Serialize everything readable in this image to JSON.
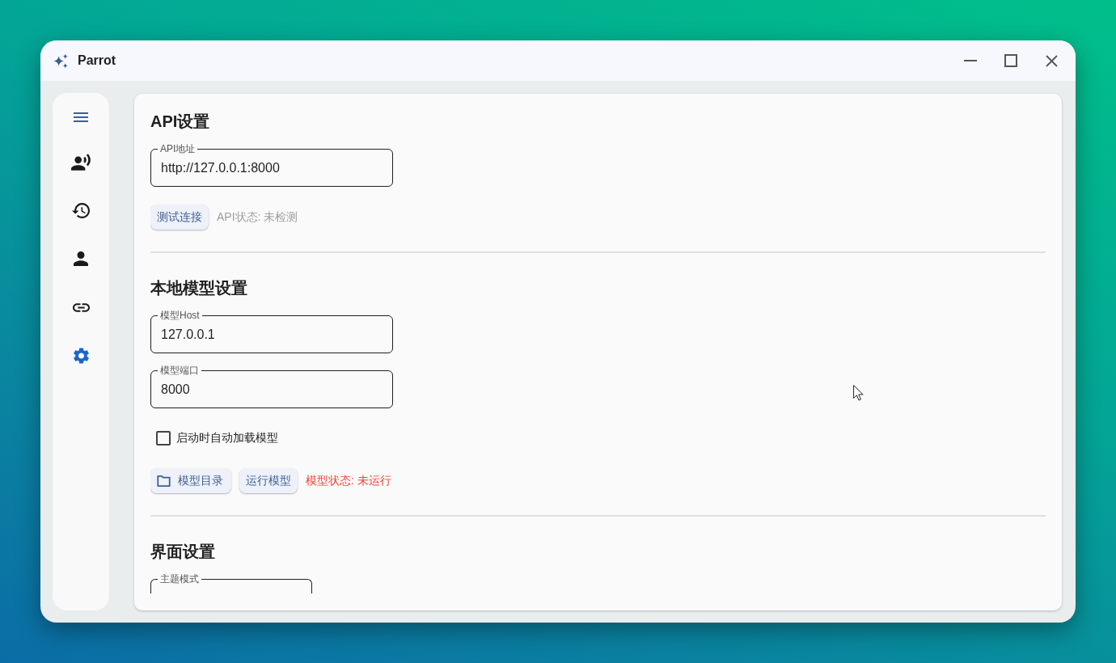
{
  "window": {
    "title": "Parrot"
  },
  "sidebar": {
    "items": [
      {
        "selected": false
      },
      {
        "selected": false
      },
      {
        "selected": false
      },
      {
        "selected": false
      },
      {
        "selected": true
      }
    ]
  },
  "sections": [
    {
      "title": "API设置",
      "controls": [
        {
          "kind": "text-field",
          "label": "API地址",
          "value": "http://127.0.0.1:8000"
        },
        {
          "kind": "actions",
          "items": [
            {
              "kind": "button",
              "label": "测试连接"
            },
            {
              "kind": "status",
              "text": "API状态: 未检测",
              "color": "#9e9e9e"
            }
          ]
        }
      ]
    },
    {
      "title": "本地模型设置",
      "controls": [
        {
          "kind": "text-field",
          "label": "模型Host",
          "value": "127.0.0.1"
        },
        {
          "kind": "text-field",
          "label": "模型端口",
          "value": "8000"
        },
        {
          "kind": "checkbox",
          "label": "启动时自动加载模型",
          "checked": false
        },
        {
          "kind": "actions",
          "items": [
            {
              "kind": "folder-button",
              "label": "模型目录"
            },
            {
              "kind": "button",
              "label": "运行模型"
            },
            {
              "kind": "status",
              "text": "模型状态: 未运行",
              "color": "#f44336"
            }
          ]
        }
      ]
    },
    {
      "title": "界面设置",
      "controls": [
        {
          "kind": "select",
          "label": "主题模式"
        }
      ]
    }
  ]
}
